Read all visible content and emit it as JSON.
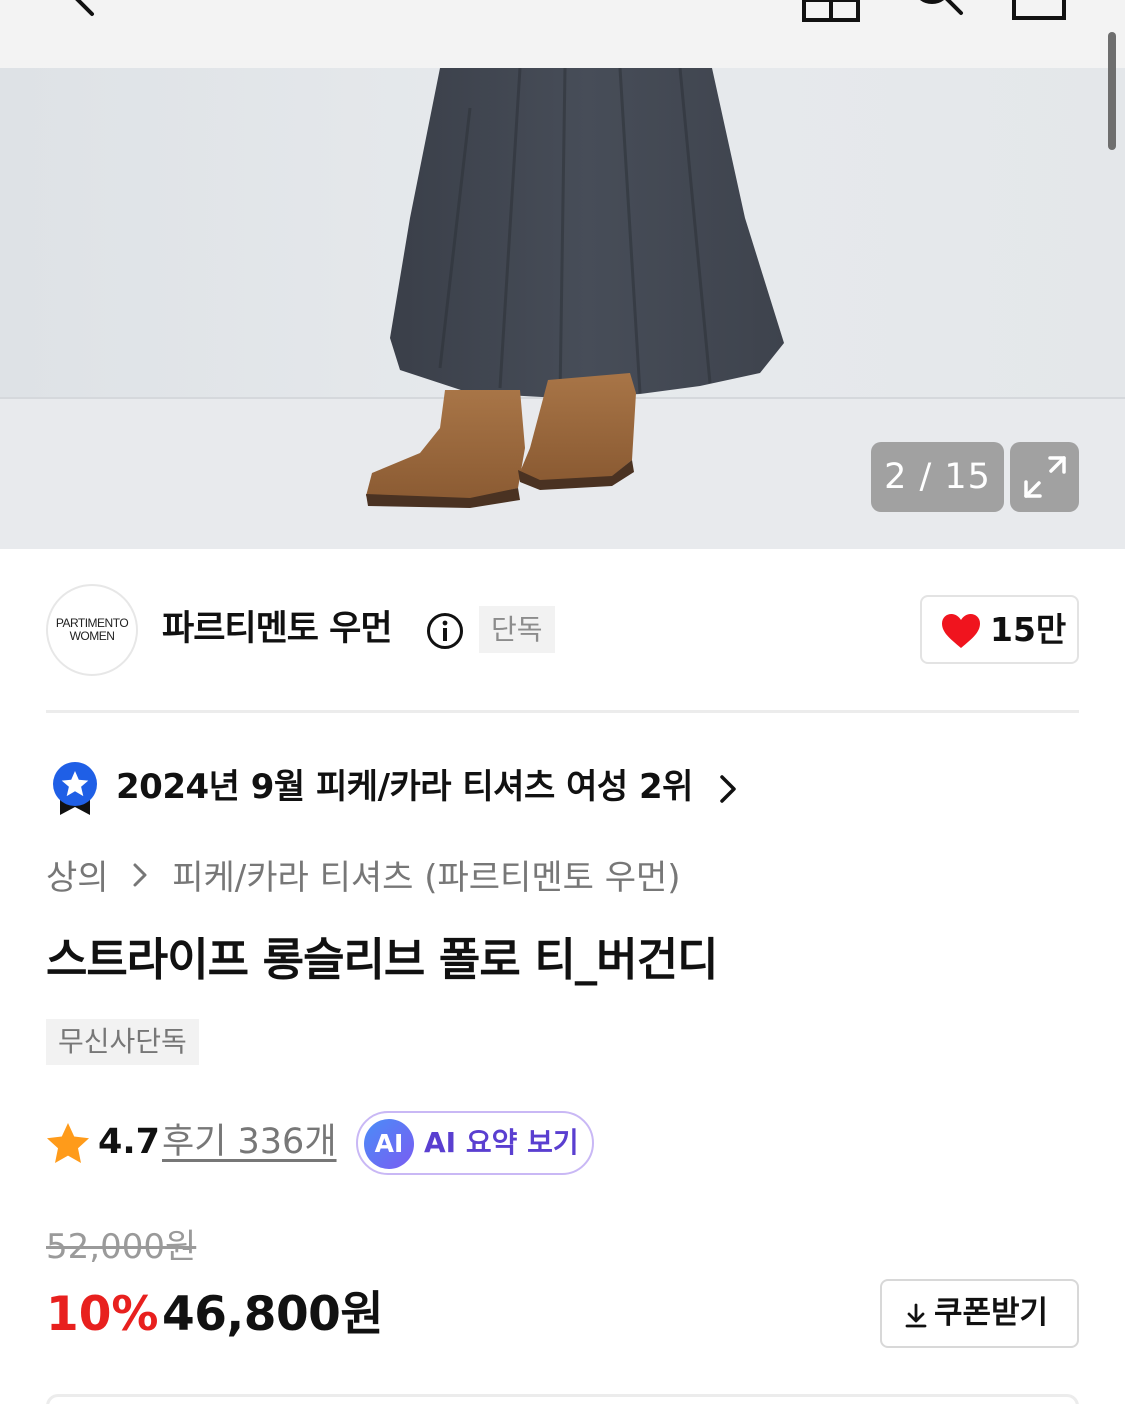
{
  "gallery": {
    "counter": "2 / 15"
  },
  "brand": {
    "logo_line1": "PARTIMENTO",
    "logo_line2": "WOMEN",
    "name": "파르티멘토 우먼",
    "exclusive_tag": "단독",
    "likes": "15만"
  },
  "ranking": {
    "text": "2024년 9월 피케/카라 티셔츠 여성 2위"
  },
  "breadcrumb": {
    "category": "상의",
    "subcategory": "피케/카라 티셔츠 (파르티멘토 우먼)"
  },
  "product": {
    "title": "스트라이프 롱슬리브 폴로 티_버건디",
    "tag": "무신사단독",
    "rating": "4.7",
    "reviews": "후기 336개",
    "ai_badge": "AI",
    "ai_summary": "AI 요약 보기"
  },
  "price": {
    "original": "52,000원",
    "discount": "10%",
    "sale": "46,800원",
    "coupon": "쿠폰받기"
  },
  "colors": {
    "accent_red": "#e8201e",
    "heart": "#f0141e",
    "star": "#ff9b1a",
    "ai_purple": "#5a3fd0",
    "medal_blue": "#1f5fe6"
  },
  "icons": {
    "topbar": [
      "back-icon",
      "home-icon",
      "search-icon",
      "cart-icon"
    ],
    "gallery": [
      "expand-icon"
    ],
    "brand": [
      "info-icon",
      "heart-icon"
    ],
    "ranking": [
      "medal-icon",
      "chevron-right-icon"
    ],
    "rating": [
      "star-icon"
    ],
    "coupon": [
      "download-icon"
    ]
  }
}
